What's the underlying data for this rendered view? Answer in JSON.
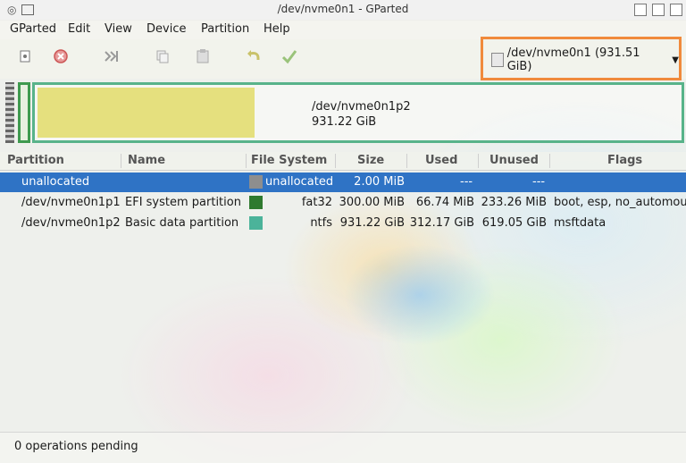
{
  "window": {
    "title": "/dev/nvme0n1 - GParted"
  },
  "menu": [
    "GParted",
    "Edit",
    "View",
    "Device",
    "Partition",
    "Help"
  ],
  "toolbar": {
    "icons": [
      "new-icon",
      "delete-icon",
      "resize-move-icon",
      "copy-icon",
      "paste-icon",
      "undo-icon",
      "apply-icon"
    ]
  },
  "device": {
    "label": "/dev/nvme0n1 (931.51 GiB)",
    "highlight_color": "#f08a3c"
  },
  "diskmap": {
    "label_name": "/dev/nvme0n1p2",
    "label_size": "931.22 GiB",
    "used_fraction": 0.335
  },
  "table": {
    "headers": [
      "Partition",
      "Name",
      "File System",
      "Size",
      "Used",
      "Unused",
      "Flags"
    ],
    "rows": [
      {
        "partition": "unallocated",
        "name": "",
        "fs_color": "#8e8e8e",
        "filesystem": "unallocated",
        "size": "2.00 MiB",
        "used": "---",
        "unused": "---",
        "flags": ""
      },
      {
        "partition": "/dev/nvme0n1p1",
        "name": "EFI system partition",
        "fs_color": "#2f7a2f",
        "filesystem": "fat32",
        "size": "300.00 MiB",
        "used": "66.74 MiB",
        "unused": "233.26 MiB",
        "flags": "boot, esp, no_automou"
      },
      {
        "partition": "/dev/nvme0n1p2",
        "name": "Basic data partition",
        "fs_color": "#4bb39a",
        "filesystem": "ntfs",
        "size": "931.22 GiB",
        "used": "312.17 GiB",
        "unused": "619.05 GiB",
        "flags": "msftdata"
      }
    ],
    "selected_color": "#2f73c5"
  },
  "status": {
    "text": "0 operations pending"
  }
}
